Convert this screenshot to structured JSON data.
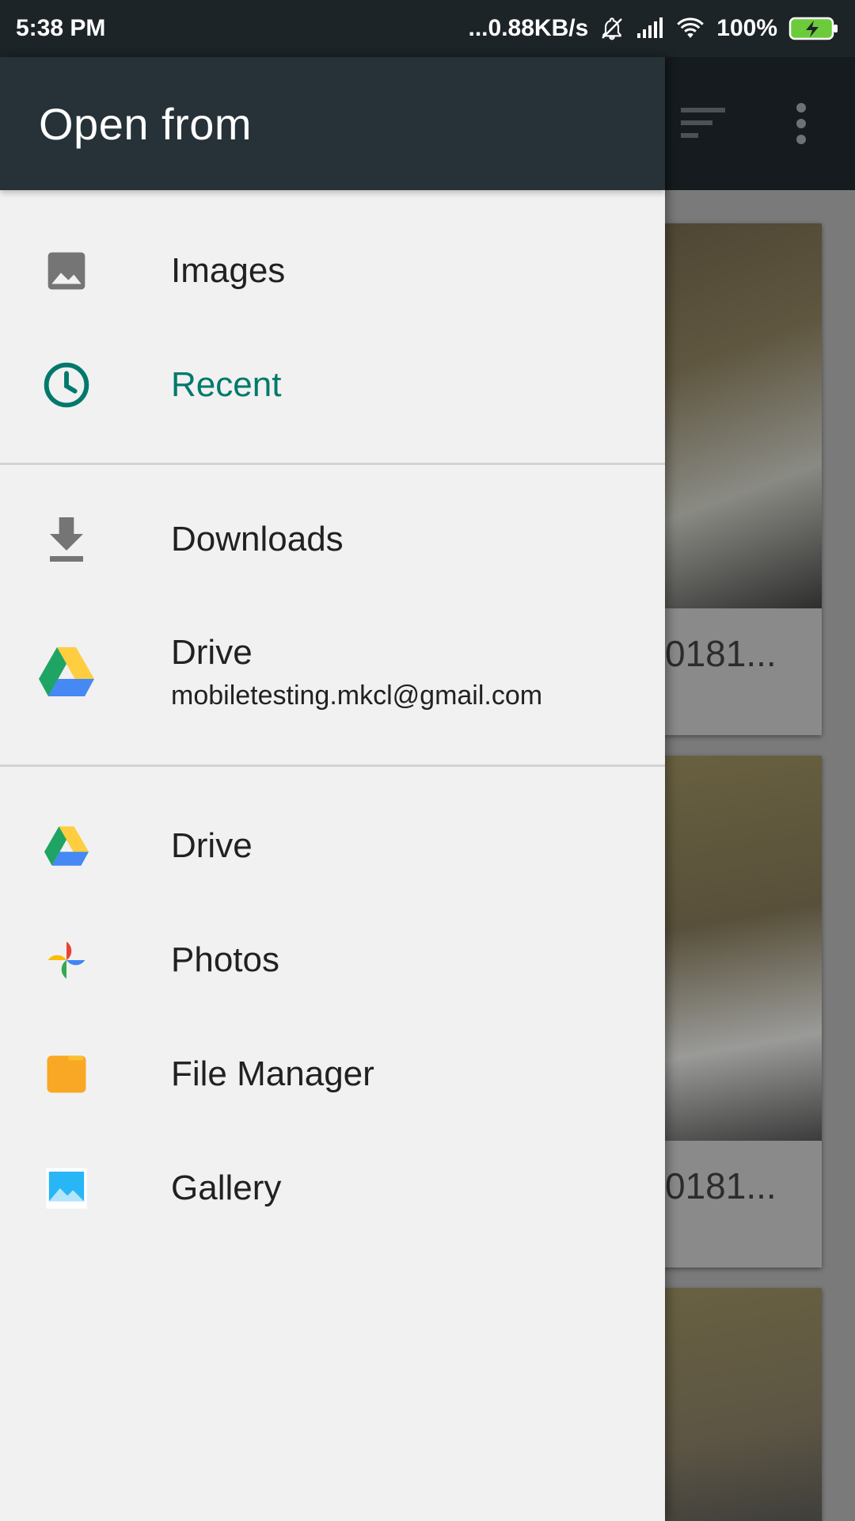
{
  "status_bar": {
    "time": "5:38 PM",
    "network_speed": "...0.88KB/s",
    "battery": "100%",
    "icons": [
      "muted-bell-icon",
      "signal-icon",
      "wifi-icon",
      "battery-charging-icon"
    ]
  },
  "drawer": {
    "title": "Open from",
    "sections": [
      {
        "items": [
          {
            "label": "Images",
            "icon": "image-icon"
          },
          {
            "label": "Recent",
            "icon": "clock-icon",
            "active": true
          }
        ]
      },
      {
        "items": [
          {
            "label": "Downloads",
            "icon": "download-icon"
          },
          {
            "label": "Drive",
            "sublabel": "mobiletesting.mkcl@gmail.com",
            "icon": "google-drive-icon"
          }
        ]
      },
      {
        "items": [
          {
            "label": "Drive",
            "icon": "google-drive-icon"
          },
          {
            "label": "Photos",
            "icon": "google-photos-icon"
          },
          {
            "label": "File Manager",
            "icon": "folder-icon"
          },
          {
            "label": "Gallery",
            "icon": "gallery-icon"
          }
        ]
      }
    ]
  },
  "background": {
    "cards": [
      {
        "caption": "0181..."
      },
      {
        "caption": "0181..."
      }
    ],
    "toolbar_icons": [
      "sort-icon",
      "more-vert-icon"
    ]
  },
  "colors": {
    "drawer_header": "#263238",
    "active_accent": "#00796b",
    "drawer_bg": "#f1f1f1"
  }
}
